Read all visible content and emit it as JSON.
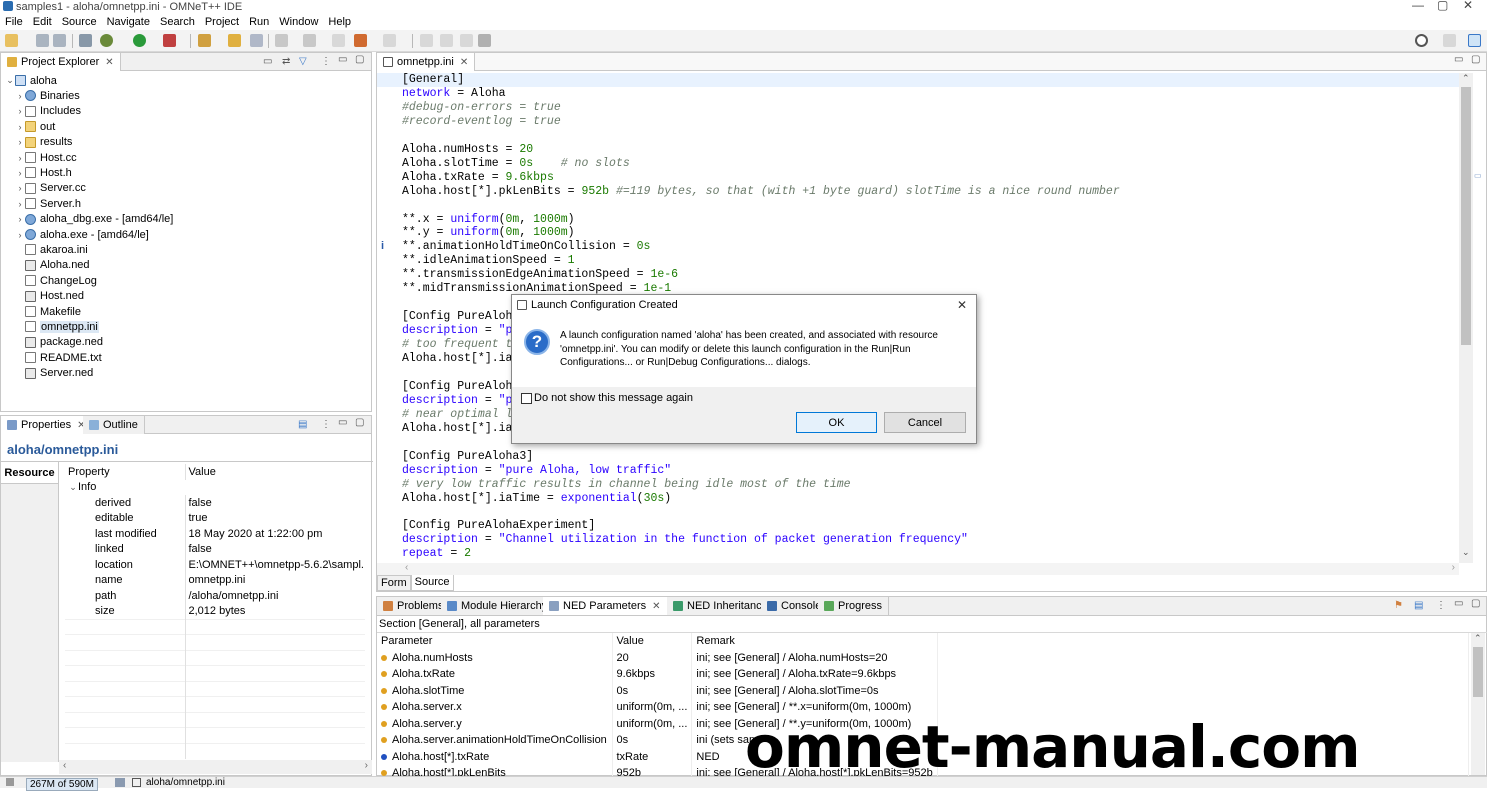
{
  "window": {
    "title": "samples1 - aloha/omnetpp.ini - OMNeT++ IDE",
    "minimize": "—",
    "maximize": "▢",
    "close": "✕"
  },
  "menu": [
    "File",
    "Edit",
    "Source",
    "Navigate",
    "Search",
    "Project",
    "Run",
    "Window",
    "Help"
  ],
  "project_explorer": {
    "tab_label": "Project Explorer",
    "root": "aloha",
    "items": [
      {
        "label": "Binaries",
        "icon": "binaries-icon",
        "expand": true
      },
      {
        "label": "Includes",
        "icon": "includes-icon",
        "expand": true
      },
      {
        "label": "out",
        "icon": "folder-icon",
        "expand": true
      },
      {
        "label": "results",
        "icon": "folder-icon",
        "expand": true
      },
      {
        "label": "Host.cc",
        "icon": "cc-file-icon",
        "expand": true
      },
      {
        "label": "Host.h",
        "icon": "h-file-icon",
        "expand": true
      },
      {
        "label": "Server.cc",
        "icon": "cc-file-icon",
        "expand": true
      },
      {
        "label": "Server.h",
        "icon": "h-file-icon",
        "expand": true
      },
      {
        "label": "aloha_dbg.exe - [amd64/le]",
        "icon": "exe-icon",
        "expand": true
      },
      {
        "label": "aloha.exe - [amd64/le]",
        "icon": "exe-icon",
        "expand": true
      },
      {
        "label": "akaroa.ini",
        "icon": "ini-file-icon",
        "expand": false
      },
      {
        "label": "Aloha.ned",
        "icon": "ned-file-icon",
        "expand": false
      },
      {
        "label": "ChangeLog",
        "icon": "text-file-icon",
        "expand": false
      },
      {
        "label": "Host.ned",
        "icon": "ned-file-icon",
        "expand": false
      },
      {
        "label": "Makefile",
        "icon": "makefile-icon",
        "expand": false
      },
      {
        "label": "omnetpp.ini",
        "icon": "ini-file-icon",
        "expand": false
      },
      {
        "label": "package.ned",
        "icon": "ned-file-icon",
        "expand": false
      },
      {
        "label": "README.txt",
        "icon": "text-file-icon",
        "expand": false
      },
      {
        "label": "Server.ned",
        "icon": "ned-file-icon",
        "expand": false
      }
    ]
  },
  "properties": {
    "tab_label": "Properties",
    "outline_label": "Outline",
    "title": "aloha/omnetpp.ini",
    "side_tab": "Resource",
    "col_property": "Property",
    "col_value": "Value",
    "group": "Info",
    "rows": [
      {
        "k": "derived",
        "v": "false"
      },
      {
        "k": "editable",
        "v": "true"
      },
      {
        "k": "last modified",
        "v": "18 May 2020 at 1:22:00 pm"
      },
      {
        "k": "linked",
        "v": "false"
      },
      {
        "k": "location",
        "v": "E:\\OMNET++\\omnetpp-5.6.2\\sampl..."
      },
      {
        "k": "name",
        "v": "omnetpp.ini"
      },
      {
        "k": "path",
        "v": "/aloha/omnetpp.ini"
      },
      {
        "k": "size",
        "v": "2,012  bytes"
      }
    ]
  },
  "editor": {
    "tab_label": "omnetpp.ini",
    "bottom_tabs": [
      "Form",
      "Source"
    ],
    "lines": [
      [
        {
          "t": "[General]",
          "c": "sec"
        }
      ],
      [
        {
          "t": "network",
          "c": "kw"
        },
        {
          "t": " = Aloha",
          "c": ""
        }
      ],
      [
        {
          "t": "#debug-on-errors = true",
          "c": "cm"
        }
      ],
      [
        {
          "t": "#record-eventlog = true",
          "c": "cm"
        }
      ],
      [],
      [
        {
          "t": "Aloha.numHosts = ",
          "c": ""
        },
        {
          "t": "20",
          "c": "num"
        }
      ],
      [
        {
          "t": "Aloha.slotTime = ",
          "c": ""
        },
        {
          "t": "0s",
          "c": "num"
        },
        {
          "t": "    # no slots",
          "c": "cm"
        }
      ],
      [
        {
          "t": "Aloha.txRate = ",
          "c": ""
        },
        {
          "t": "9.6kbps",
          "c": "num"
        }
      ],
      [
        {
          "t": "Aloha.host[*].pkLenBits = ",
          "c": ""
        },
        {
          "t": "952b",
          "c": "num"
        },
        {
          "t": " #=119 bytes, so that (with +1 byte guard) slotTime is a nice round number",
          "c": "cm"
        }
      ],
      [],
      [
        {
          "t": "**.x = ",
          "c": ""
        },
        {
          "t": "uniform",
          "c": "kw"
        },
        {
          "t": "(",
          "c": ""
        },
        {
          "t": "0m",
          "c": "num"
        },
        {
          "t": ", ",
          "c": ""
        },
        {
          "t": "1000m",
          "c": "num"
        },
        {
          "t": ")",
          "c": ""
        }
      ],
      [
        {
          "t": "**.y = ",
          "c": ""
        },
        {
          "t": "uniform",
          "c": "kw"
        },
        {
          "t": "(",
          "c": ""
        },
        {
          "t": "0m",
          "c": "num"
        },
        {
          "t": ", ",
          "c": ""
        },
        {
          "t": "1000m",
          "c": "num"
        },
        {
          "t": ")",
          "c": ""
        }
      ],
      [
        {
          "t": "**.animationHoldTimeOnCollision = ",
          "c": ""
        },
        {
          "t": "0s",
          "c": "num"
        }
      ],
      [
        {
          "t": "**.idleAnimationSpeed = ",
          "c": ""
        },
        {
          "t": "1",
          "c": "num"
        }
      ],
      [
        {
          "t": "**.transmissionEdgeAnimationSpeed = ",
          "c": ""
        },
        {
          "t": "1e-6",
          "c": "num"
        }
      ],
      [
        {
          "t": "**.midTransmissionAnimationSpeed = ",
          "c": ""
        },
        {
          "t": "1e-1",
          "c": "num"
        }
      ],
      [],
      [
        {
          "t": "[Config PureAloha1",
          "c": "sec"
        }
      ],
      [
        {
          "t": "description",
          "c": "kw"
        },
        {
          "t": " = ",
          "c": ""
        },
        {
          "t": "\"pur",
          "c": "str"
        }
      ],
      [
        {
          "t": "# too frequent tra",
          "c": "cm"
        }
      ],
      [
        {
          "t": "Aloha.host[*].iaTi",
          "c": ""
        }
      ],
      [],
      [
        {
          "t": "[Config PureAloha2",
          "c": "sec"
        }
      ],
      [
        {
          "t": "description",
          "c": "kw"
        },
        {
          "t": " = ",
          "c": ""
        },
        {
          "t": "\"pur",
          "c": "str"
        }
      ],
      [
        {
          "t": "# near optimal loa",
          "c": "cm"
        }
      ],
      [
        {
          "t": "Aloha.host[*].iaTi",
          "c": ""
        }
      ],
      [],
      [
        {
          "t": "[Config PureAloha3]",
          "c": "sec"
        }
      ],
      [
        {
          "t": "description",
          "c": "kw"
        },
        {
          "t": " = ",
          "c": ""
        },
        {
          "t": "\"pure Aloha, low traffic\"",
          "c": "str"
        }
      ],
      [
        {
          "t": "# very low traffic results in channel being idle most of the time",
          "c": "cm"
        }
      ],
      [
        {
          "t": "Aloha.host[*].iaTime = ",
          "c": ""
        },
        {
          "t": "exponential",
          "c": "kw"
        },
        {
          "t": "(",
          "c": ""
        },
        {
          "t": "30s",
          "c": "num"
        },
        {
          "t": ")",
          "c": ""
        }
      ],
      [],
      [
        {
          "t": "[Config PureAlohaExperiment]",
          "c": "sec"
        }
      ],
      [
        {
          "t": "description",
          "c": "kw"
        },
        {
          "t": " = ",
          "c": ""
        },
        {
          "t": "\"Channel utilization in the function of packet generation frequency\"",
          "c": "str"
        }
      ],
      [
        {
          "t": "repeat",
          "c": "kw"
        },
        {
          "t": " = ",
          "c": ""
        },
        {
          "t": "2",
          "c": "num"
        }
      ]
    ]
  },
  "dialog": {
    "title": "Launch Configuration Created",
    "message_1": "A launch configuration named 'aloha' has been created, and associated with resource",
    "message_2": "'omnetpp.ini'. You can modify or delete this launch configuration in the Run|Run",
    "message_3": "Configurations... or Run|Debug Configurations... dialogs.",
    "checkbox": "Do not show this message again",
    "ok": "OK",
    "cancel": "Cancel",
    "close": "✕"
  },
  "bottom_panel": {
    "tabs": [
      "Problems",
      "Module Hierarchy",
      "NED Parameters",
      "NED Inheritance",
      "Console",
      "Progress"
    ],
    "section": "Section [General], all parameters",
    "columns": [
      "Parameter",
      "Value",
      "Remark"
    ],
    "rows": [
      {
        "p": "Aloha.numHosts",
        "v": "20",
        "r": "ini; see [General] / Aloha.numHosts=20",
        "dot": "orange"
      },
      {
        "p": "Aloha.txRate",
        "v": "9.6kbps",
        "r": "ini; see [General] / Aloha.txRate=9.6kbps",
        "dot": "orange"
      },
      {
        "p": "Aloha.slotTime",
        "v": "0s",
        "r": "ini; see [General] / Aloha.slotTime=0s",
        "dot": "orange"
      },
      {
        "p": "Aloha.server.x",
        "v": "uniform(0m, ...",
        "r": "ini; see [General] / **.x=uniform(0m, 1000m)",
        "dot": "orange"
      },
      {
        "p": "Aloha.server.y",
        "v": "uniform(0m, ...",
        "r": "ini; see [General] / **.y=uniform(0m, 1000m)",
        "dot": "orange"
      },
      {
        "p": "Aloha.server.animationHoldTimeOnCollision",
        "v": "0s",
        "r": "ini (sets sam",
        "dot": "orange"
      },
      {
        "p": "Aloha.host[*].txRate",
        "v": "txRate",
        "r": "NED",
        "dot": "blue"
      },
      {
        "p": "Aloha.host[*].pkLenBits",
        "v": "952b",
        "r": "ini; see [General] / Aloha.host[*].pkLenBits=952b",
        "dot": "orange"
      }
    ]
  },
  "status": {
    "memory": "267M of 590M",
    "file": "aloha/omnetpp.ini"
  },
  "watermark": "omnet-manual.com",
  "colors": {
    "accent": "#0078d7",
    "keyword": "#2a00ff",
    "number": "#1a7a00",
    "comment": "#6a7a6a"
  }
}
